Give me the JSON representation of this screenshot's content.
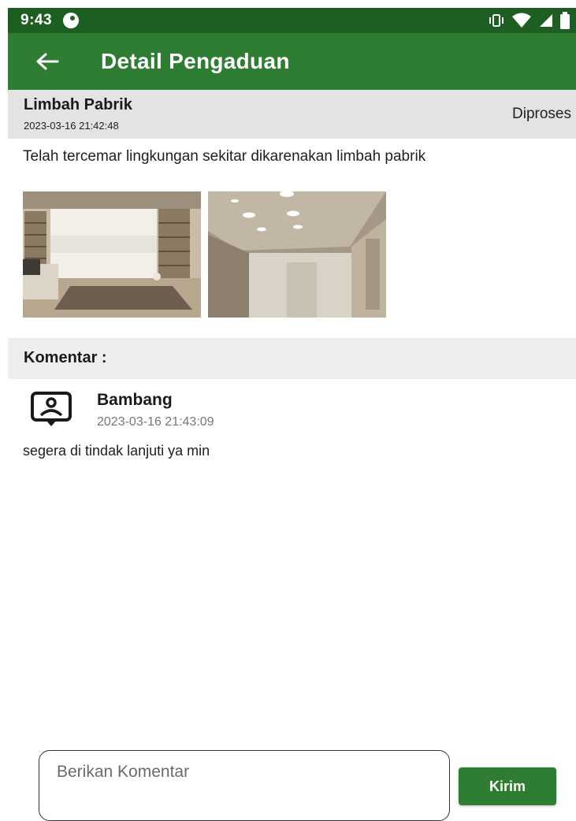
{
  "status_bar": {
    "time": "9:43"
  },
  "app_bar": {
    "title": "Detail Pengaduan",
    "color": "#2e7d32"
  },
  "report": {
    "title": "Limbah Pabrik",
    "date": "2023-03-16 21:42:48",
    "status": "Diproses",
    "description": "Telah tercemar lingkungan sekitar dikarenakan limbah pabrik"
  },
  "comments_section": {
    "label": "Komentar :",
    "items": [
      {
        "author": "Bambang",
        "date": "2023-03-16 21:43:09",
        "text": "segera di tindak lanjuti ya min"
      }
    ]
  },
  "composer": {
    "placeholder": "Berikan Komentar",
    "send_label": "Kirim"
  }
}
